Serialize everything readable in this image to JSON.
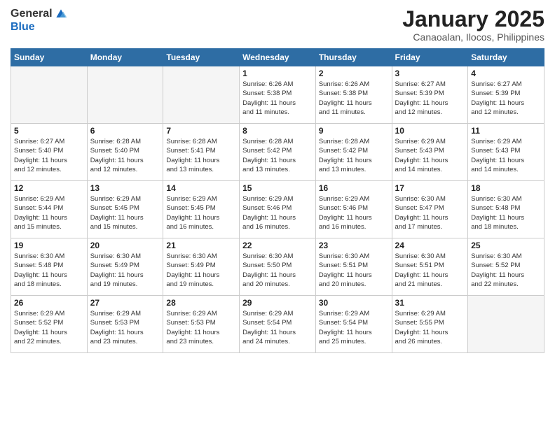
{
  "logo": {
    "general": "General",
    "blue": "Blue"
  },
  "header": {
    "month": "January 2025",
    "location": "Canaoalan, Ilocos, Philippines"
  },
  "weekdays": [
    "Sunday",
    "Monday",
    "Tuesday",
    "Wednesday",
    "Thursday",
    "Friday",
    "Saturday"
  ],
  "weeks": [
    [
      {
        "day": "",
        "info": ""
      },
      {
        "day": "",
        "info": ""
      },
      {
        "day": "",
        "info": ""
      },
      {
        "day": "1",
        "info": "Sunrise: 6:26 AM\nSunset: 5:38 PM\nDaylight: 11 hours\nand 11 minutes."
      },
      {
        "day": "2",
        "info": "Sunrise: 6:26 AM\nSunset: 5:38 PM\nDaylight: 11 hours\nand 11 minutes."
      },
      {
        "day": "3",
        "info": "Sunrise: 6:27 AM\nSunset: 5:39 PM\nDaylight: 11 hours\nand 12 minutes."
      },
      {
        "day": "4",
        "info": "Sunrise: 6:27 AM\nSunset: 5:39 PM\nDaylight: 11 hours\nand 12 minutes."
      }
    ],
    [
      {
        "day": "5",
        "info": "Sunrise: 6:27 AM\nSunset: 5:40 PM\nDaylight: 11 hours\nand 12 minutes."
      },
      {
        "day": "6",
        "info": "Sunrise: 6:28 AM\nSunset: 5:40 PM\nDaylight: 11 hours\nand 12 minutes."
      },
      {
        "day": "7",
        "info": "Sunrise: 6:28 AM\nSunset: 5:41 PM\nDaylight: 11 hours\nand 13 minutes."
      },
      {
        "day": "8",
        "info": "Sunrise: 6:28 AM\nSunset: 5:42 PM\nDaylight: 11 hours\nand 13 minutes."
      },
      {
        "day": "9",
        "info": "Sunrise: 6:28 AM\nSunset: 5:42 PM\nDaylight: 11 hours\nand 13 minutes."
      },
      {
        "day": "10",
        "info": "Sunrise: 6:29 AM\nSunset: 5:43 PM\nDaylight: 11 hours\nand 14 minutes."
      },
      {
        "day": "11",
        "info": "Sunrise: 6:29 AM\nSunset: 5:43 PM\nDaylight: 11 hours\nand 14 minutes."
      }
    ],
    [
      {
        "day": "12",
        "info": "Sunrise: 6:29 AM\nSunset: 5:44 PM\nDaylight: 11 hours\nand 15 minutes."
      },
      {
        "day": "13",
        "info": "Sunrise: 6:29 AM\nSunset: 5:45 PM\nDaylight: 11 hours\nand 15 minutes."
      },
      {
        "day": "14",
        "info": "Sunrise: 6:29 AM\nSunset: 5:45 PM\nDaylight: 11 hours\nand 16 minutes."
      },
      {
        "day": "15",
        "info": "Sunrise: 6:29 AM\nSunset: 5:46 PM\nDaylight: 11 hours\nand 16 minutes."
      },
      {
        "day": "16",
        "info": "Sunrise: 6:29 AM\nSunset: 5:46 PM\nDaylight: 11 hours\nand 16 minutes."
      },
      {
        "day": "17",
        "info": "Sunrise: 6:30 AM\nSunset: 5:47 PM\nDaylight: 11 hours\nand 17 minutes."
      },
      {
        "day": "18",
        "info": "Sunrise: 6:30 AM\nSunset: 5:48 PM\nDaylight: 11 hours\nand 18 minutes."
      }
    ],
    [
      {
        "day": "19",
        "info": "Sunrise: 6:30 AM\nSunset: 5:48 PM\nDaylight: 11 hours\nand 18 minutes."
      },
      {
        "day": "20",
        "info": "Sunrise: 6:30 AM\nSunset: 5:49 PM\nDaylight: 11 hours\nand 19 minutes."
      },
      {
        "day": "21",
        "info": "Sunrise: 6:30 AM\nSunset: 5:49 PM\nDaylight: 11 hours\nand 19 minutes."
      },
      {
        "day": "22",
        "info": "Sunrise: 6:30 AM\nSunset: 5:50 PM\nDaylight: 11 hours\nand 20 minutes."
      },
      {
        "day": "23",
        "info": "Sunrise: 6:30 AM\nSunset: 5:51 PM\nDaylight: 11 hours\nand 20 minutes."
      },
      {
        "day": "24",
        "info": "Sunrise: 6:30 AM\nSunset: 5:51 PM\nDaylight: 11 hours\nand 21 minutes."
      },
      {
        "day": "25",
        "info": "Sunrise: 6:30 AM\nSunset: 5:52 PM\nDaylight: 11 hours\nand 22 minutes."
      }
    ],
    [
      {
        "day": "26",
        "info": "Sunrise: 6:29 AM\nSunset: 5:52 PM\nDaylight: 11 hours\nand 22 minutes."
      },
      {
        "day": "27",
        "info": "Sunrise: 6:29 AM\nSunset: 5:53 PM\nDaylight: 11 hours\nand 23 minutes."
      },
      {
        "day": "28",
        "info": "Sunrise: 6:29 AM\nSunset: 5:53 PM\nDaylight: 11 hours\nand 23 minutes."
      },
      {
        "day": "29",
        "info": "Sunrise: 6:29 AM\nSunset: 5:54 PM\nDaylight: 11 hours\nand 24 minutes."
      },
      {
        "day": "30",
        "info": "Sunrise: 6:29 AM\nSunset: 5:54 PM\nDaylight: 11 hours\nand 25 minutes."
      },
      {
        "day": "31",
        "info": "Sunrise: 6:29 AM\nSunset: 5:55 PM\nDaylight: 11 hours\nand 26 minutes."
      },
      {
        "day": "",
        "info": ""
      }
    ]
  ]
}
